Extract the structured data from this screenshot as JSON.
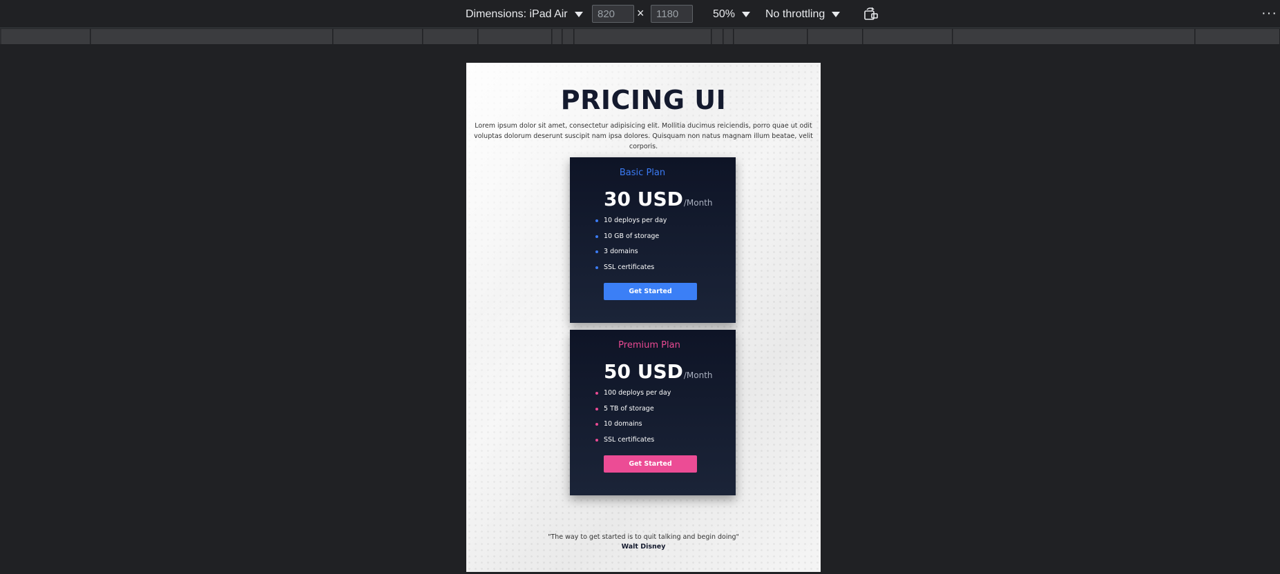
{
  "devtools": {
    "dimensions_label": "Dimensions: iPad Air",
    "width_value": "820",
    "height_value": "1180",
    "times_symbol": "×",
    "zoom_label": "50%",
    "throttling_label": "No throttling",
    "more_symbol": "···"
  },
  "page": {
    "title": "PRICING UI",
    "description": "Lorem ipsum dolor sit amet, consectetur adipisicing elit. Mollitia ducimus reiciendis, porro quae ut odit voluptas dolorum deserunt suscipit nam ipsa dolores. Quisquam non natus magnam illum beatae, velit corporis.",
    "plans": [
      {
        "name": "Basic Plan",
        "price": "30 USD",
        "period": "/Month",
        "features": [
          "10 deploys per day",
          "10 GB of storage",
          "3 domains",
          "SSL certificates"
        ],
        "button": "Get Started",
        "accent": "#3b7bf5"
      },
      {
        "name": "Premium Plan",
        "price": "50 USD",
        "period": "/Month",
        "features": [
          "100 deploys per day",
          "5 TB of storage",
          "10 domains",
          "SSL certificates"
        ],
        "button": "Get Started",
        "accent": "#ea4a93"
      }
    ],
    "quote": "\"The way to get started is to quit talking and begin doing\"",
    "author": "Walt Disney"
  }
}
